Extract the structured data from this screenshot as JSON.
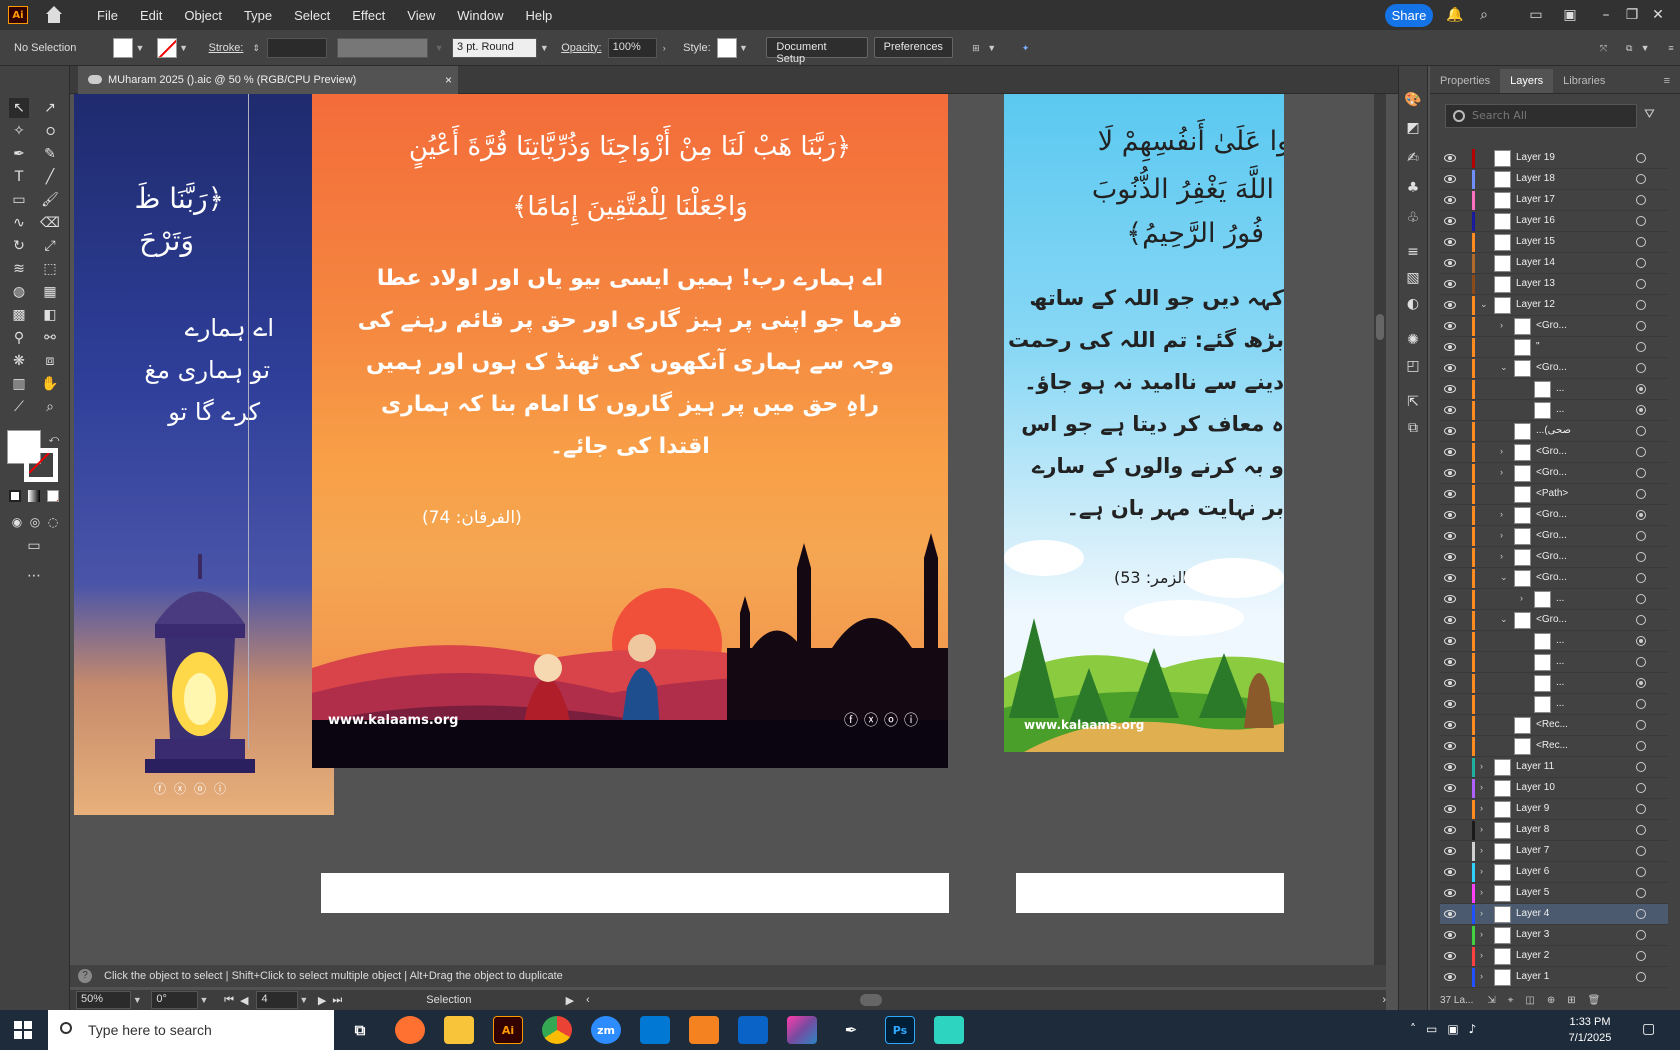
{
  "app": {
    "logo": "Ai",
    "menu": [
      "File",
      "Edit",
      "Object",
      "Type",
      "Select",
      "Effect",
      "View",
      "Window",
      "Help"
    ],
    "share_label": "Share"
  },
  "control": {
    "selection": "No Selection",
    "stroke_label": "Stroke:",
    "brush": "3 pt. Round",
    "opacity_label": "Opacity:",
    "opacity": "100%",
    "style_label": "Style:",
    "doc_setup": "Document Setup",
    "preferences": "Preferences"
  },
  "document": {
    "tab_title": "MUharam 2025 ().aic @ 50 % (RGB/CPU Preview)",
    "close": "×"
  },
  "artboards": {
    "left": {
      "ayah1": "﴿رَبَّنَا ظَ",
      "ayah2": "وَتَرْحَ",
      "urdu1": "اے ہمارے",
      "urdu2": "تو ہماری مغ",
      "urdu3": "کرے گا تو"
    },
    "center": {
      "ayah_line1": "﴿رَبَّنَا هَبْ لَنَا مِنْ أَزْوَاجِنَا وَذُرِّيَّاتِنَا قُرَّةَ أَعْيُنٍ",
      "ayah_line2": "وَاجْعَلْنَا لِلْمُتَّقِينَ إِمَامًا﴾",
      "urdu_line1": "اے ہمارے رب! ہمیں ایسی بیو یاں اور اولاد عطا",
      "urdu_line2": "فرما جو اپنی پر ہیز گاری اور حق پر قائم رہنے کی",
      "urdu_line3": "وجہ سے ہماری آنکھوں کی ٹھنڈ ک ہوں اور ہمیں",
      "urdu_line4": "راہِ حق میں پر ہیز گاروں کا امام بنا کہ ہماری",
      "urdu_line5": "اقتدا کی جائے۔",
      "reference": "(الفرقان: 74)",
      "website": "www.kalaams.org"
    },
    "right": {
      "ayah_line1": "فُوا عَلَىٰ أَنفُسِهِمْ لَا",
      "ayah_line2": "اللَّهَ يَغْفِرُ الذُّنُوبَ",
      "ayah_line3": "فُورُ الرَّحِيمُ﴾",
      "urdu_line1": "کہہ دیں جو اللہ کے ساتھ",
      "urdu_line2": "بڑھ گئے: تم اللہ کی رحمت",
      "urdu_line3": "دینے سے ناامید نہ ہو جاؤ۔",
      "urdu_line4": "ہ معاف کر دیتا ہے جو اس",
      "urdu_line5": "و بہ کرنے والوں کے سارے",
      "urdu_line6": "بر نہایت مہر بان ہے۔",
      "reference": "(الزمر: 53)",
      "website": "www.kalaams.org"
    }
  },
  "status": {
    "hint": "Click the object to select  |  Shift+Click to select multiple object  |  Alt+Drag the object to duplicate",
    "zoom": "50%",
    "rotation": "0°",
    "artboard": "4",
    "tool": "Selection"
  },
  "panel": {
    "tabs": [
      "Properties",
      "Layers",
      "Libraries"
    ],
    "search_placeholder": "Search All",
    "layers_count": "37 La...",
    "layers": [
      {
        "name": "Layer 19",
        "color": "#b40000",
        "depth": 0,
        "arrow": "",
        "target": "empty"
      },
      {
        "name": "Layer 18",
        "color": "#6f8fff",
        "depth": 0,
        "arrow": "",
        "target": "empty"
      },
      {
        "name": "Layer 17",
        "color": "#ff70c0",
        "depth": 0,
        "arrow": "",
        "target": "empty"
      },
      {
        "name": "Layer 16",
        "color": "#1a1aa0",
        "depth": 0,
        "arrow": "",
        "target": "empty"
      },
      {
        "name": "Layer 15",
        "color": "#ff8a20",
        "depth": 0,
        "arrow": "",
        "target": "empty"
      },
      {
        "name": "Layer 14",
        "color": "#b06a2a",
        "depth": 0,
        "arrow": "",
        "target": "empty"
      },
      {
        "name": "Layer 13",
        "color": "#8a4a1a",
        "depth": 0,
        "arrow": "",
        "target": "empty"
      },
      {
        "name": "Layer 12",
        "color": "#ff8a20",
        "depth": 0,
        "arrow": "open",
        "target": "empty"
      },
      {
        "name": "<Gro...",
        "color": "#ff8a20",
        "depth": 1,
        "arrow": "closed",
        "target": "empty"
      },
      {
        "name": "\"",
        "color": "#ff8a20",
        "depth": 1,
        "arrow": "",
        "target": "empty"
      },
      {
        "name": "<Gro...",
        "color": "#ff8a20",
        "depth": 1,
        "arrow": "open",
        "target": "empty"
      },
      {
        "name": "...",
        "color": "#ff8a20",
        "depth": 2,
        "arrow": "",
        "target": "fill"
      },
      {
        "name": "...",
        "color": "#ff8a20",
        "depth": 2,
        "arrow": "",
        "target": "fill"
      },
      {
        "name": "...(صحی",
        "color": "#ff8a20",
        "depth": 1,
        "arrow": "",
        "target": "empty"
      },
      {
        "name": "<Gro...",
        "color": "#ff8a20",
        "depth": 1,
        "arrow": "closed",
        "target": "empty"
      },
      {
        "name": "<Gro...",
        "color": "#ff8a20",
        "depth": 1,
        "arrow": "closed",
        "target": "empty"
      },
      {
        "name": "<Path>",
        "color": "#ff8a20",
        "depth": 1,
        "arrow": "",
        "target": "empty"
      },
      {
        "name": "<Gro...",
        "color": "#ff8a20",
        "depth": 1,
        "arrow": "closed",
        "target": "fill"
      },
      {
        "name": "<Gro...",
        "color": "#ff8a20",
        "depth": 1,
        "arrow": "closed",
        "target": "empty"
      },
      {
        "name": "<Gro...",
        "color": "#ff8a20",
        "depth": 1,
        "arrow": "closed",
        "target": "empty"
      },
      {
        "name": "<Gro...",
        "color": "#ff8a20",
        "depth": 1,
        "arrow": "open",
        "target": "empty"
      },
      {
        "name": "...",
        "color": "#ff8a20",
        "depth": 2,
        "arrow": "closed",
        "target": "empty"
      },
      {
        "name": "<Gro...",
        "color": "#ff8a20",
        "depth": 1,
        "arrow": "open",
        "target": "empty"
      },
      {
        "name": "...",
        "color": "#ff8a20",
        "depth": 2,
        "arrow": "",
        "target": "fill"
      },
      {
        "name": "...",
        "color": "#ff8a20",
        "depth": 2,
        "arrow": "",
        "target": "empty"
      },
      {
        "name": "...",
        "color": "#ff8a20",
        "depth": 2,
        "arrow": "",
        "target": "fill"
      },
      {
        "name": "...",
        "color": "#ff8a20",
        "depth": 2,
        "arrow": "",
        "target": "empty"
      },
      {
        "name": "<Rec...",
        "color": "#ff8a20",
        "depth": 1,
        "arrow": "",
        "target": "empty"
      },
      {
        "name": "<Rec...",
        "color": "#ff8a20",
        "depth": 1,
        "arrow": "",
        "target": "empty"
      },
      {
        "name": "Layer 11",
        "color": "#20b0a0",
        "depth": 0,
        "arrow": "closed",
        "target": "empty"
      },
      {
        "name": "Layer 10",
        "color": "#b060ff",
        "depth": 0,
        "arrow": "closed",
        "target": "empty"
      },
      {
        "name": "Layer 9",
        "color": "#ff8a20",
        "depth": 0,
        "arrow": "closed",
        "target": "empty"
      },
      {
        "name": "Layer 8",
        "color": "#1a1a1a",
        "depth": 0,
        "arrow": "closed",
        "target": "empty"
      },
      {
        "name": "Layer 7",
        "color": "#d0d0d0",
        "depth": 0,
        "arrow": "closed",
        "target": "empty"
      },
      {
        "name": "Layer 6",
        "color": "#30d0ff",
        "depth": 0,
        "arrow": "closed",
        "target": "empty"
      },
      {
        "name": "Layer 5",
        "color": "#ff40ff",
        "depth": 0,
        "arrow": "closed",
        "target": "empty"
      },
      {
        "name": "Layer 4",
        "color": "#2050ff",
        "depth": 0,
        "arrow": "closed",
        "target": "empty",
        "selected": true
      },
      {
        "name": "Layer 3",
        "color": "#40d040",
        "depth": 0,
        "arrow": "closed",
        "target": "empty"
      },
      {
        "name": "Layer 2",
        "color": "#ff4040",
        "depth": 0,
        "arrow": "closed",
        "target": "empty"
      },
      {
        "name": "Layer 1",
        "color": "#2050ff",
        "depth": 0,
        "arrow": "closed",
        "target": "empty"
      }
    ]
  },
  "taskbar": {
    "search_placeholder": "Type here to search",
    "time": "1:33 PM",
    "date": "7/1/2025"
  }
}
